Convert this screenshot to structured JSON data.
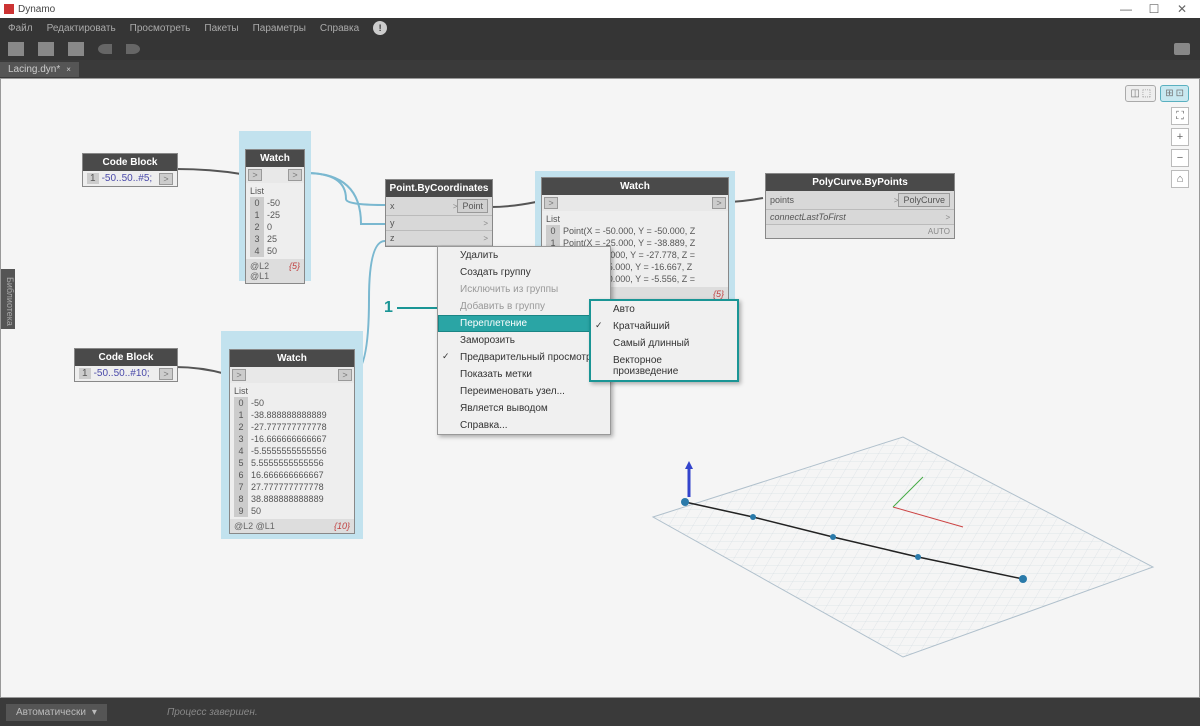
{
  "app": {
    "title": "Dynamo"
  },
  "winbtns": {
    "min": "—",
    "max": "☐",
    "close": "✕"
  },
  "menu": {
    "file": "Файл",
    "edit": "Редактировать",
    "view": "Просмотреть",
    "packages": "Пакеты",
    "params": "Параметры",
    "help": "Справка",
    "info": "!"
  },
  "tab": {
    "name": "Lacing.dyn*",
    "close": "×"
  },
  "sidebar": {
    "label": "Библиотека"
  },
  "nav": {
    "fit": "⛶",
    "plus": "+",
    "minus": "−",
    "home": "⌂"
  },
  "callout": {
    "num": "1"
  },
  "nodes": {
    "cb1": {
      "title": "Code Block",
      "ln": "1",
      "code": "-50..50..#5;",
      "port": ">"
    },
    "cb2": {
      "title": "Code Block",
      "ln": "1",
      "code": "-50..50..#10;",
      "port": ">"
    },
    "watch1": {
      "title": "Watch",
      "in": ">",
      "out": ">",
      "header": "List",
      "rows": [
        {
          "i": "0",
          "v": "-50"
        },
        {
          "i": "1",
          "v": "-25"
        },
        {
          "i": "2",
          "v": "0"
        },
        {
          "i": "3",
          "v": "25"
        },
        {
          "i": "4",
          "v": "50"
        }
      ],
      "footL": "@L2 @L1",
      "footR": "{5}"
    },
    "watch2": {
      "title": "Watch",
      "in": ">",
      "out": ">",
      "header": "List",
      "rows": [
        {
          "i": "0",
          "v": "-50"
        },
        {
          "i": "1",
          "v": "-38.888888888889"
        },
        {
          "i": "2",
          "v": "-27.777777777778"
        },
        {
          "i": "3",
          "v": "-16.666666666667"
        },
        {
          "i": "4",
          "v": "-5.5555555555556"
        },
        {
          "i": "5",
          "v": "5.5555555555556"
        },
        {
          "i": "6",
          "v": "16.666666666667"
        },
        {
          "i": "7",
          "v": "27.777777777778"
        },
        {
          "i": "8",
          "v": "38.888888888889"
        },
        {
          "i": "9",
          "v": "50"
        }
      ],
      "footL": "@L2 @L1",
      "footR": "{10}"
    },
    "pbc": {
      "title": "Point.ByCoordinates",
      "x": "x",
      "y": "y",
      "z": "z",
      "out": "Point",
      "chev": ">"
    },
    "watch3": {
      "title": "Watch",
      "in": ">",
      "out": ">",
      "header": "List",
      "rows": [
        {
          "i": "0",
          "v": "Point(X = -50.000, Y = -50.000, Z"
        },
        {
          "i": "1",
          "v": "Point(X = -25.000, Y = -38.889, Z"
        },
        {
          "i": "2",
          "v": "Point(X = 0.000, Y = -27.778, Z ="
        },
        {
          "i": "3",
          "v": "Point(X = 25.000, Y = -16.667, Z"
        },
        {
          "i": "4",
          "v": "Point(X = 50.000, Y = -5.556, Z ="
        }
      ],
      "footR": "{5}"
    },
    "poly": {
      "title": "PolyCurve.ByPoints",
      "p1": "points",
      "p2": "connectLastToFirst",
      "out": "PolyCurve",
      "chev": ">",
      "auto": "AUTO"
    }
  },
  "ctx": {
    "items": [
      {
        "label": "Удалить"
      },
      {
        "label": "Создать группу"
      },
      {
        "label": "Исключить из группы",
        "disabled": true
      },
      {
        "label": "Добавить в группу",
        "disabled": true
      },
      {
        "label": "Переплетение",
        "hl": true,
        "sub": true
      },
      {
        "label": "Заморозить"
      },
      {
        "label": "Предварительный просмотр",
        "checked": true
      },
      {
        "label": "Показать метки"
      },
      {
        "label": "Переименовать узел..."
      },
      {
        "label": "Является выводом"
      },
      {
        "label": "Справка..."
      }
    ],
    "sub": [
      {
        "label": "Авто"
      },
      {
        "label": "Кратчайший",
        "checked": true
      },
      {
        "label": "Самый длинный"
      },
      {
        "label": "Векторное произведение"
      }
    ]
  },
  "status": {
    "mode": "Автоматически",
    "arr": "▾",
    "msg": "Процесс завершен."
  }
}
